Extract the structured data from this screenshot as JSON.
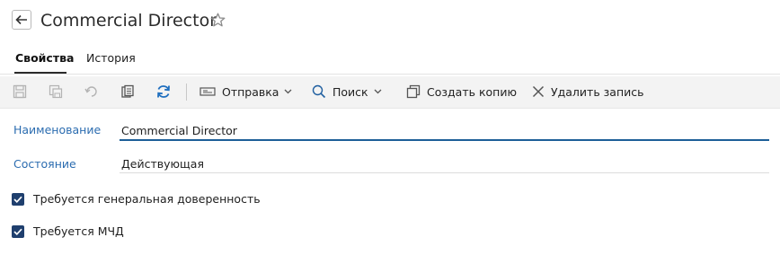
{
  "header": {
    "title": "Commercial Director"
  },
  "tabs": [
    {
      "label": "Свойства",
      "active": true
    },
    {
      "label": "История",
      "active": false
    }
  ],
  "toolbar": {
    "send_label": "Отправка",
    "search_label": "Поиск",
    "copy_label": "Создать копию",
    "delete_label": "Удалить запись"
  },
  "form": {
    "name": {
      "label": "Наименование",
      "value": "Commercial Director"
    },
    "state": {
      "label": "Состояние",
      "value": "Действующая"
    },
    "checkboxes": [
      {
        "label": "Требуется генеральная доверенность",
        "checked": true
      },
      {
        "label": "Требуется МЧД",
        "checked": true
      }
    ]
  },
  "colors": {
    "accent": "#1d5f98",
    "label_blue": "#2b6cb0",
    "refresh_blue": "#1f6fbf",
    "checkbox": "#1f3f6e",
    "toolbar_bg": "#f3f3f3"
  }
}
